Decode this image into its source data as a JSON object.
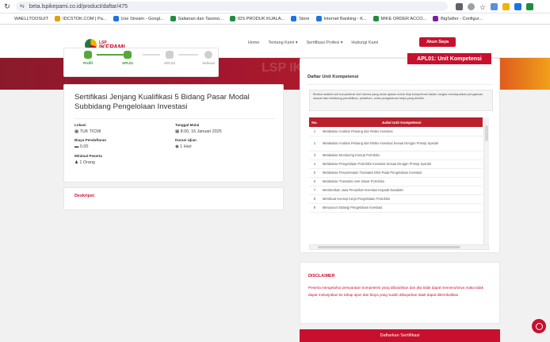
{
  "browser": {
    "url": "beta.lspikepami.co.id/product/daftar/475",
    "bookmarks": [
      "WAELLTOOSUIT",
      "IDCSTOK.COM | Pa...",
      "Use Stream - Googl...",
      "Saltanan dan Taxono...",
      "IDS PRODUK KUALA...",
      "Store",
      "Internet Banking - K...",
      "MIKE ORDER ACCO...",
      "BigSeller - Configur..."
    ],
    "bookmark_colors": [
      "#ffffff",
      "#e3a008",
      "#1a73e8",
      "#1e8e3e",
      "#1e8e3e",
      "#1a73e8",
      "#1a73e8",
      "#1e8e3e",
      "#7b1fa2"
    ]
  },
  "nav": {
    "logo_top": "LSP",
    "logo_main": "IKEPAMI",
    "links": [
      "Home",
      "Tentang Kami ▾",
      "Sertifikasi Profesi ▾",
      "Hubungi Kami"
    ],
    "account_button": "Akun Saya"
  },
  "hero_ghost": "LSP IKEP",
  "steps": [
    {
      "label": "Profil",
      "active": true
    },
    {
      "label": "APL01",
      "active": true
    },
    {
      "label": "APL02",
      "active": false
    },
    {
      "label": "Selesai",
      "active": false
    }
  ],
  "scheme": {
    "title": "Sertifikasi Jenjang Kualifikasi 5 Bidang Pasar Modal Subbidang Pengelolaan Investasi",
    "lokasi_label": "Lokasi",
    "lokasi_value": "TUK TICMI",
    "tanggal_label": "Tanggal Mulai",
    "tanggal_value": "8:00, 16 Januari 2025",
    "biaya_label": "Biaya Pendaftaran",
    "biaya_value": "0,00",
    "durasi_label": "Durasi Ujian",
    "durasi_value": "1 Hari",
    "minimal_label": "Minimal Peserta",
    "minimal_value": "1 Orang"
  },
  "deskripsi_label": "Deskripsi:",
  "apl": {
    "badge": "APL01: Unit Kompetensi",
    "title": "Daftar Unit Kompetensi",
    "note": "Berikut adalah unit kompetensi dari skema yang anda ajukan untuk diuji kompetensi dalam rangka mendapatkan pengakuan sesuai latar belakang pendidikan, pelatihan, serta pengalaman kerja yang dimiliki.",
    "columns": [
      "No.",
      "Judul Unit Kompetensi"
    ],
    "rows": [
      {
        "no": "1",
        "title": "Melakukan Analisis Peluang dan Risiko Investasi"
      },
      {
        "no": "2",
        "title": "Melakukan Analisis Peluang dan Risiko Investasi Sesuai Dengan Prinsip Syariah"
      },
      {
        "no": "3",
        "title": "Melakukan Monitoring Kinerja Portofolio"
      },
      {
        "no": "4",
        "title": "Melakukan Pengelolaan Portofolio Investasi Sesuai Dengan Prinsip Syariah"
      },
      {
        "no": "5",
        "title": "Melakukan Penyelesaian Transaksi Efek Pada Pengelolaan Investasi"
      },
      {
        "no": "6",
        "title": "Melakukan Transaksi Aset Dasar Portofolio"
      },
      {
        "no": "7",
        "title": "Memberikan Jasa Penasihat Investasi Kepada Nasabah"
      },
      {
        "no": "8",
        "title": "Membuat Konsep Kerja Pengelolaan Portofolio"
      },
      {
        "no": "9",
        "title": "Menyusun Strategi Pengelolaan Investasi"
      }
    ]
  },
  "disclaimer": {
    "title": "DISCLAIMER",
    "text": "Peserta mengetahui persyaratan kompetensi yang dibutuhkan dan jika tidak dapat memenuhinya maka tidak dapat melanjutkan ke tahap ujian dan biaya yang sudah dibayarkan tidak dapat dikembalikan."
  },
  "submit_button": "Daftarkan Sertifikasi",
  "colors": {
    "brand": "#c8102e",
    "step_active": "#58a73b"
  }
}
